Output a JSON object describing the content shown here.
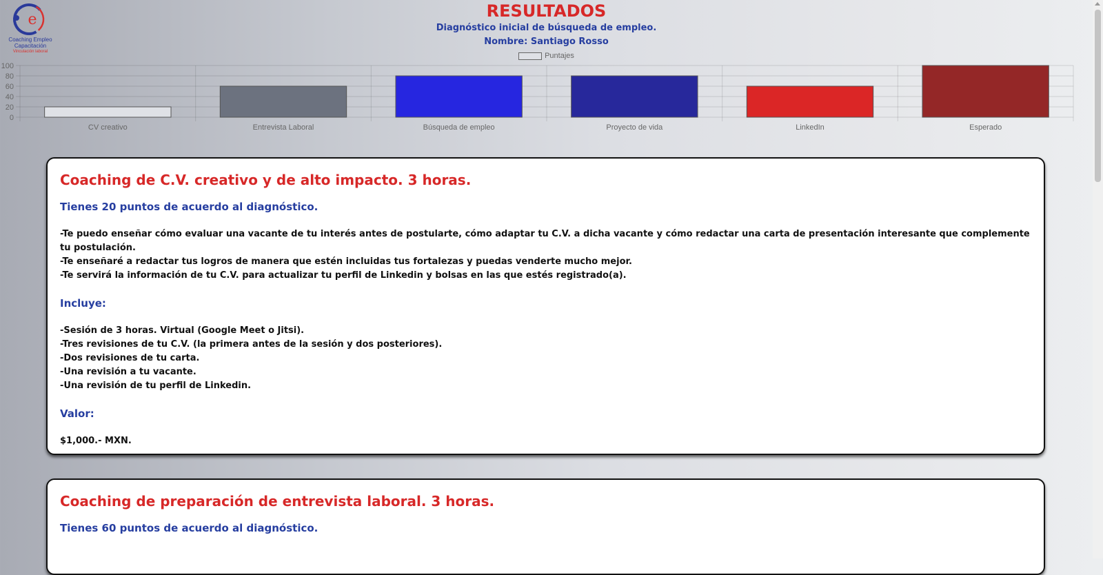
{
  "logo": {
    "line1": "Coaching Empleo",
    "line2": "Capacitación",
    "line3": "Vinculación laboral",
    "colors": {
      "blue": "#2a3a9a",
      "red": "#d9322f"
    }
  },
  "header": {
    "title": "RESULTADOS",
    "subtitle": "Diagnóstico inicial de búsqueda de empleo.",
    "nombre_label": "Nombre:",
    "nombre_value": "Santiago Rosso"
  },
  "chart_data": {
    "type": "bar",
    "categories": [
      "CV creativo",
      "Entrevista Laboral",
      "Búsqueda de empleo",
      "Proyecto de vida",
      "LinkedIn",
      "Esperado"
    ],
    "series": [
      {
        "name": "Puntajes",
        "values": [
          20,
          60,
          80,
          80,
          60,
          100
        ]
      }
    ],
    "bar_colors": [
      "#dfe1e6",
      "#6c727f",
      "#2626e0",
      "#27289b",
      "#db2626",
      "#942727"
    ],
    "yticks": [
      "0",
      "20",
      "40",
      "60",
      "80",
      "100"
    ],
    "ylim": [
      0,
      100
    ],
    "grid": true,
    "legend_position": "top"
  },
  "cards": [
    {
      "title": "Coaching de C.V. creativo y de alto impacto. 3 horas.",
      "points": "Tienes 20 puntos de acuerdo al diagnóstico.",
      "bullets": [
        "-Te puedo enseñar cómo evaluar una vacante de tu interés antes de postularte, cómo adaptar tu C.V. a dicha vacante y cómo redactar una carta de presentación interesante que complemente tu postulación.",
        "-Te enseñaré a redactar tus logros de manera que estén incluidas tus fortalezas y puedas venderte mucho mejor.",
        "-Te servirá la información de tu C.V. para actualizar tu perfil de Linkedin y bolsas en las que estés registrado(a)."
      ],
      "incluye_label": "Incluye:",
      "incluye": [
        "-Sesión de 3 horas. Virtual (Google Meet o Jitsi).",
        "-Tres revisiones de tu C.V. (la primera antes de la sesión y dos posteriores).",
        "-Dos revisiones de tu carta.",
        "-Una revisión a tu vacante.",
        "-Una revisión de tu perfil de Linkedin."
      ],
      "valor_label": "Valor:",
      "price": "$1,000.- MXN."
    },
    {
      "title": "Coaching de preparación de entrevista laboral. 3 horas.",
      "points": "Tienes 60 puntos de acuerdo al diagnóstico."
    }
  ],
  "colors": {
    "accent_red": "#d72828",
    "accent_blue": "#263ea0"
  }
}
